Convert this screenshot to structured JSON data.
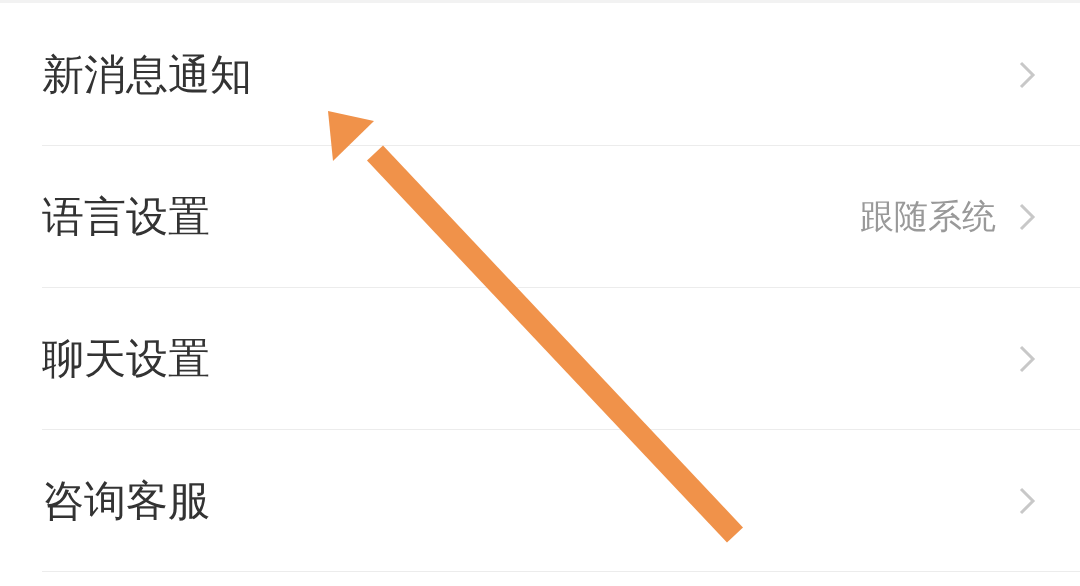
{
  "settings": [
    {
      "label": "新消息通知"
    },
    {
      "label": "语言设置",
      "value": "跟随系统"
    },
    {
      "label": "聊天设置"
    },
    {
      "label": "咨询客服"
    }
  ]
}
